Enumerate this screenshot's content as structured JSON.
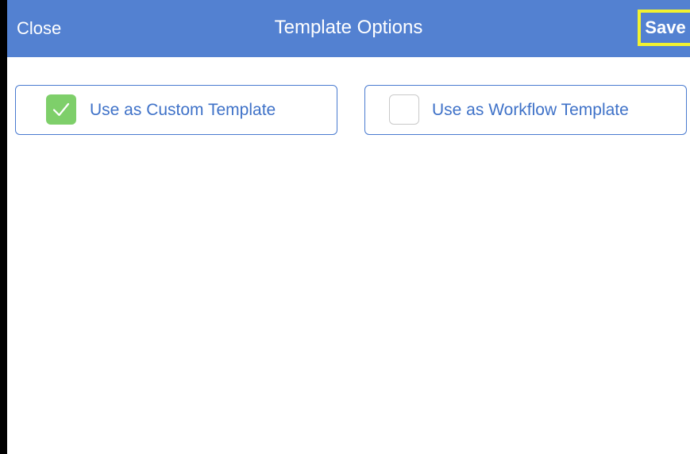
{
  "navbar": {
    "close_label": "Close",
    "title": "Template Options",
    "save_label": "Save"
  },
  "options": {
    "custom": {
      "label": "Use as Custom Template",
      "checked": true
    },
    "workflow": {
      "label": "Use as Workflow Template",
      "checked": false
    }
  },
  "colors": {
    "navbar_bg": "#5381d1",
    "accent": "#3f72c8",
    "check_green": "#7ecf6a",
    "highlight_yellow": "#f2f230"
  },
  "icons": {
    "checked_box": "checkmark-icon",
    "unchecked_box": "empty-checkbox-icon"
  }
}
